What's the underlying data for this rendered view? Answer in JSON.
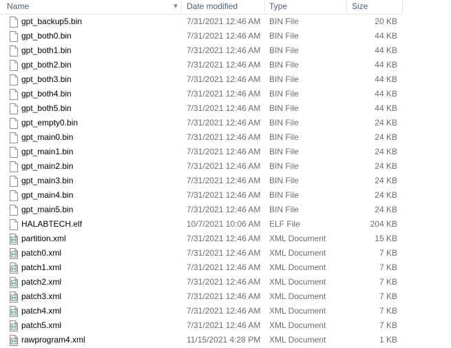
{
  "columns": {
    "name": "Name",
    "date": "Date modified",
    "type": "Type",
    "size": "Size"
  },
  "files": [
    {
      "name": "gpt_backup5.bin",
      "date": "7/31/2021 12:46 AM",
      "type": "BIN File",
      "size": "20 KB",
      "icon": "blank-file-icon"
    },
    {
      "name": "gpt_both0.bin",
      "date": "7/31/2021 12:46 AM",
      "type": "BIN File",
      "size": "44 KB",
      "icon": "blank-file-icon"
    },
    {
      "name": "gpt_both1.bin",
      "date": "7/31/2021 12:46 AM",
      "type": "BIN File",
      "size": "44 KB",
      "icon": "blank-file-icon"
    },
    {
      "name": "gpt_both2.bin",
      "date": "7/31/2021 12:46 AM",
      "type": "BIN File",
      "size": "44 KB",
      "icon": "blank-file-icon"
    },
    {
      "name": "gpt_both3.bin",
      "date": "7/31/2021 12:46 AM",
      "type": "BIN File",
      "size": "44 KB",
      "icon": "blank-file-icon"
    },
    {
      "name": "gpt_both4.bin",
      "date": "7/31/2021 12:46 AM",
      "type": "BIN File",
      "size": "44 KB",
      "icon": "blank-file-icon"
    },
    {
      "name": "gpt_both5.bin",
      "date": "7/31/2021 12:46 AM",
      "type": "BIN File",
      "size": "44 KB",
      "icon": "blank-file-icon"
    },
    {
      "name": "gpt_empty0.bin",
      "date": "7/31/2021 12:46 AM",
      "type": "BIN File",
      "size": "24 KB",
      "icon": "blank-file-icon"
    },
    {
      "name": "gpt_main0.bin",
      "date": "7/31/2021 12:46 AM",
      "type": "BIN File",
      "size": "24 KB",
      "icon": "blank-file-icon"
    },
    {
      "name": "gpt_main1.bin",
      "date": "7/31/2021 12:46 AM",
      "type": "BIN File",
      "size": "24 KB",
      "icon": "blank-file-icon"
    },
    {
      "name": "gpt_main2.bin",
      "date": "7/31/2021 12:46 AM",
      "type": "BIN File",
      "size": "24 KB",
      "icon": "blank-file-icon"
    },
    {
      "name": "gpt_main3.bin",
      "date": "7/31/2021 12:46 AM",
      "type": "BIN File",
      "size": "24 KB",
      "icon": "blank-file-icon"
    },
    {
      "name": "gpt_main4.bin",
      "date": "7/31/2021 12:46 AM",
      "type": "BIN File",
      "size": "24 KB",
      "icon": "blank-file-icon"
    },
    {
      "name": "gpt_main5.bin",
      "date": "7/31/2021 12:46 AM",
      "type": "BIN File",
      "size": "24 KB",
      "icon": "blank-file-icon"
    },
    {
      "name": "HALABTECH.elf",
      "date": "10/7/2021 10:06 AM",
      "type": "ELF File",
      "size": "204 KB",
      "icon": "blank-file-icon"
    },
    {
      "name": "partition.xml",
      "date": "7/31/2021 12:46 AM",
      "type": "XML Document",
      "size": "15 KB",
      "icon": "xml-document-icon"
    },
    {
      "name": "patch0.xml",
      "date": "7/31/2021 12:46 AM",
      "type": "XML Document",
      "size": "7 KB",
      "icon": "xml-document-icon"
    },
    {
      "name": "patch1.xml",
      "date": "7/31/2021 12:46 AM",
      "type": "XML Document",
      "size": "7 KB",
      "icon": "xml-document-icon"
    },
    {
      "name": "patch2.xml",
      "date": "7/31/2021 12:46 AM",
      "type": "XML Document",
      "size": "7 KB",
      "icon": "xml-document-icon"
    },
    {
      "name": "patch3.xml",
      "date": "7/31/2021 12:46 AM",
      "type": "XML Document",
      "size": "7 KB",
      "icon": "xml-document-icon"
    },
    {
      "name": "patch4.xml",
      "date": "7/31/2021 12:46 AM",
      "type": "XML Document",
      "size": "7 KB",
      "icon": "xml-document-icon"
    },
    {
      "name": "patch5.xml",
      "date": "7/31/2021 12:46 AM",
      "type": "XML Document",
      "size": "7 KB",
      "icon": "xml-document-icon"
    },
    {
      "name": "rawprogram4.xml",
      "date": "11/15/2021 4:28 PM",
      "type": "XML Document",
      "size": "1 KB",
      "icon": "xml-document-icon"
    }
  ]
}
